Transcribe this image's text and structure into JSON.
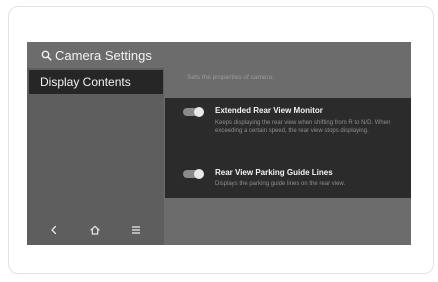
{
  "header": {
    "title": "Camera Settings",
    "icon": "search-icon"
  },
  "sidebar": {
    "items": [
      {
        "label": "Display Contents",
        "selected": true
      }
    ]
  },
  "nav": {
    "items": [
      {
        "icon": "back-arrow-icon"
      },
      {
        "icon": "home-icon"
      },
      {
        "icon": "menu-icon"
      }
    ]
  },
  "content": {
    "description": "Sets the properties of camera.",
    "settings": [
      {
        "title": "Extended Rear View Monitor",
        "description": "Keeps displaying the rear view when shifting from R to N/D. When exceeding a certain speed, the rear view stops displaying.",
        "enabled": true
      },
      {
        "title": "Rear View Parking Guide Lines",
        "description": "Displays the parking guide lines on the rear view.",
        "enabled": true
      }
    ]
  },
  "colors": {
    "screen_background": "#6c6c6c",
    "panel_background": "#2b2b2b",
    "selected_item_background": "#262626",
    "primary_text": "#f2f2f2",
    "secondary_text": "#8e8e8e"
  }
}
